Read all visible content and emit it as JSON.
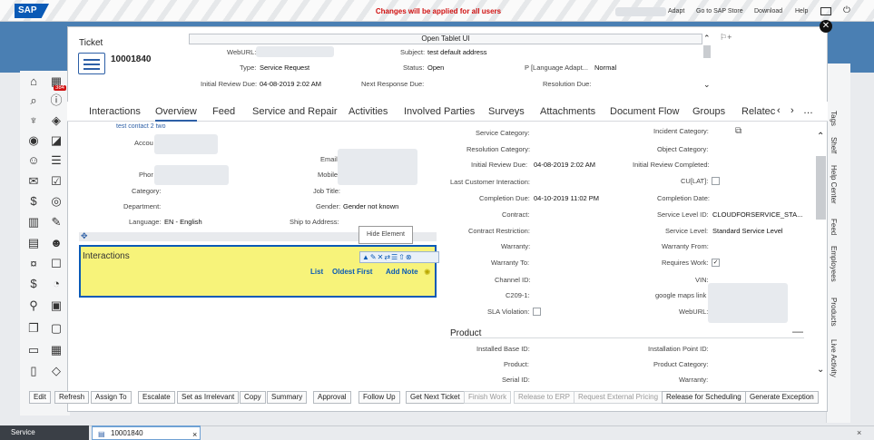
{
  "topbar": {
    "logo": "SAP",
    "message": "Changes will be applied for all users",
    "links": [
      "Adapt",
      "Go to SAP Store",
      "Download",
      "Help"
    ]
  },
  "right_tabs": [
    "Tags",
    "Shelf",
    "Help Center",
    "Feed",
    "Employees",
    "Products",
    "Live Activity"
  ],
  "nav_badge": "384",
  "ticket": {
    "title": "Ticket",
    "number": "10001840",
    "header_bar": "Open Tablet UI",
    "header_fields": [
      {
        "label": "WebURL:",
        "value": ""
      },
      {
        "label": "Subject:",
        "value": "test default address"
      },
      {
        "label": "Type:",
        "value": "Service Request"
      },
      {
        "label": "Status:",
        "value": "Open"
      },
      {
        "label": "P [Language Adapt...",
        "value": "Normal"
      },
      {
        "label": "Initial Review Due:",
        "value": "04-08-2019 2:02 AM"
      },
      {
        "label": "Next Response Due:",
        "value": ""
      },
      {
        "label": "Resolution Due:",
        "value": ""
      }
    ]
  },
  "tabs": [
    "Interactions",
    "Overview",
    "Feed",
    "Service and Repair",
    "Activities",
    "Involved Parties",
    "Surveys",
    "Attachments",
    "Document Flow",
    "Groups",
    "Relatec"
  ],
  "left_fields": {
    "contact_link": "test contact 2 two",
    "account_label": "Accou",
    "email_label": "Email",
    "phone_label": "Phor",
    "mobile_label": "Mobile",
    "category_label": "Category:",
    "jobtitle_label": "Job Title:",
    "department_label": "Department:",
    "gender_label": "Gender:",
    "gender_value": "Gender not known",
    "language_label": "Language:",
    "language_value": "EN - English",
    "ship_label": "Ship to Address:"
  },
  "hide_element": "Hide Element",
  "interactions_box": {
    "title": "Interactions",
    "links": [
      "List",
      "Oldest First",
      "Add Note"
    ]
  },
  "mid_fields": {
    "service_category": "Service Category:",
    "resolution_category": "Resolution Category:",
    "initial_review_due_label": "Initial Review Due:",
    "initial_review_due_value": "04-08-2019 2:02 AM",
    "last_customer_interaction": "Last Customer Interaction:",
    "completion_due_label": "Completion Due:",
    "completion_due_value": "04-10-2019 11:02 PM",
    "contract": "Contract:",
    "contract_restriction": "Contract Restriction:",
    "warranty": "Warranty:",
    "warranty_to": "Warranty To:",
    "channel_id": "Channel ID:",
    "c209": "C209-1:",
    "sla_violation": "SLA Violation:"
  },
  "right_fields": {
    "incident_category": "Incident Category:",
    "object_category": "Object Category:",
    "initial_review_completed": "Initial Review Completed:",
    "cu_lat": "CU[LAT]:",
    "completion_date": "Completion Date:",
    "service_level_id_label": "Service Level ID:",
    "service_level_id_value": "CLOUDFORSERVICE_STA...",
    "service_level_label": "Service Level:",
    "service_level_value": "Standard Service Level",
    "warranty_from": "Warranty From:",
    "requires_work": "Requires Work:",
    "vin": "VIN:",
    "google_maps": "google maps link",
    "weburl": "WebURL:"
  },
  "product": {
    "title": "Product",
    "installed_base_id": "Installed Base ID:",
    "product": "Product:",
    "serial_id": "Serial ID:",
    "installation_point_id": "Installation Point ID:",
    "product_category": "Product Category:",
    "warranty": "Warranty:"
  },
  "buttons": [
    {
      "label": "Edit",
      "disabled": false
    },
    {
      "label": "Refresh",
      "disabled": false
    },
    {
      "label": "Assign To",
      "disabled": false
    },
    {
      "label": "Escalate",
      "disabled": false
    },
    {
      "label": "Set as Irrelevant",
      "disabled": false
    },
    {
      "label": "Copy",
      "disabled": false
    },
    {
      "label": "Summary",
      "disabled": false
    },
    {
      "label": "Approval",
      "disabled": false
    },
    {
      "label": "Follow Up",
      "disabled": false
    },
    {
      "label": "Get Next Ticket",
      "disabled": false
    },
    {
      "label": "Finish Work",
      "disabled": true
    },
    {
      "label": "Release to ERP",
      "disabled": true
    },
    {
      "label": "Request External Pricing",
      "disabled": true
    },
    {
      "label": "Release for Scheduling",
      "disabled": false
    },
    {
      "label": "Generate Exception",
      "disabled": false
    }
  ],
  "bottom": {
    "service_label": "Service",
    "tab_label": "10001840",
    "close_glyph": "×"
  },
  "colors": {
    "accent": "#0a5ab6",
    "warning_text": "#d01010",
    "highlight": "#f7f37a"
  }
}
